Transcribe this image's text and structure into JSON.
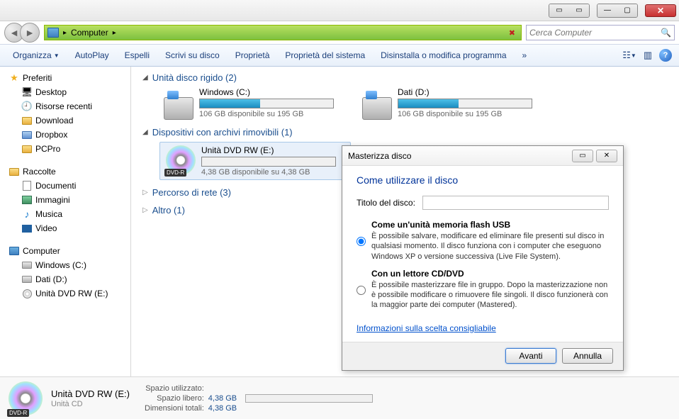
{
  "titlebar": {},
  "address": {
    "crumb1": "Computer",
    "search_placeholder": "Cerca Computer"
  },
  "toolbar": {
    "organize": "Organizza",
    "autoplay": "AutoPlay",
    "eject": "Espelli",
    "write": "Scrivi su disco",
    "properties": "Proprietà",
    "system_props": "Proprietà del sistema",
    "uninstall": "Disinstalla o modifica programma",
    "chevron": "»"
  },
  "sidebar": {
    "favorites": "Preferiti",
    "desktop": "Desktop",
    "recent": "Risorse recenti",
    "download": "Download",
    "dropbox": "Dropbox",
    "pcpro": "PCPro",
    "libraries": "Raccolte",
    "documents": "Documenti",
    "pictures": "Immagini",
    "music": "Musica",
    "videos": "Video",
    "computer": "Computer",
    "c": "Windows (C:)",
    "d": "Dati (D:)",
    "e": "Unità DVD RW (E:)"
  },
  "content": {
    "hdd_header": "Unità disco rigido (2)",
    "removable_header": "Dispositivi con archivi rimovibili (1)",
    "network_header": "Percorso di rete (3)",
    "other_header": "Altro (1)",
    "drive_c": {
      "name": "Windows (C:)",
      "fill_pct": 45,
      "stat": "106 GB disponibile su 195 GB"
    },
    "drive_d": {
      "name": "Dati (D:)",
      "fill_pct": 45,
      "stat": "106 GB disponibile su 195 GB"
    },
    "dvd": {
      "name": "Unità DVD RW (E:)",
      "badge": "DVD-R",
      "fill_pct": 0,
      "stat": "4,38 GB disponibile su 4,38 GB"
    }
  },
  "details": {
    "title": "Unità DVD RW (E:)",
    "subtitle": "Unità CD",
    "badge": "DVD-R",
    "used_label": "Spazio utilizzato:",
    "free_label": "Spazio libero:",
    "total_label": "Dimensioni totali:",
    "free_val": "4,38 GB",
    "total_val": "4,38 GB"
  },
  "dialog": {
    "title": "Masterizza disco",
    "heading": "Come utilizzare il disco",
    "field_label": "Titolo del disco:",
    "field_value": "",
    "opt1_title": "Come un'unità memoria flash USB",
    "opt1_desc": "È possibile salvare, modificare ed eliminare file presenti sul disco in qualsiasi momento. Il disco funziona con i computer che eseguono Windows XP o versione successiva (Live File System).",
    "opt2_title": "Con un lettore CD/DVD",
    "opt2_desc": "È possibile masterizzare file in gruppo. Dopo la masterizzazione non è possibile modificare o rimuovere file singoli. Il disco funzionerà con la maggior parte dei computer (Mastered).",
    "link": "Informazioni sulla scelta consigliabile",
    "next": "Avanti",
    "cancel": "Annulla"
  }
}
